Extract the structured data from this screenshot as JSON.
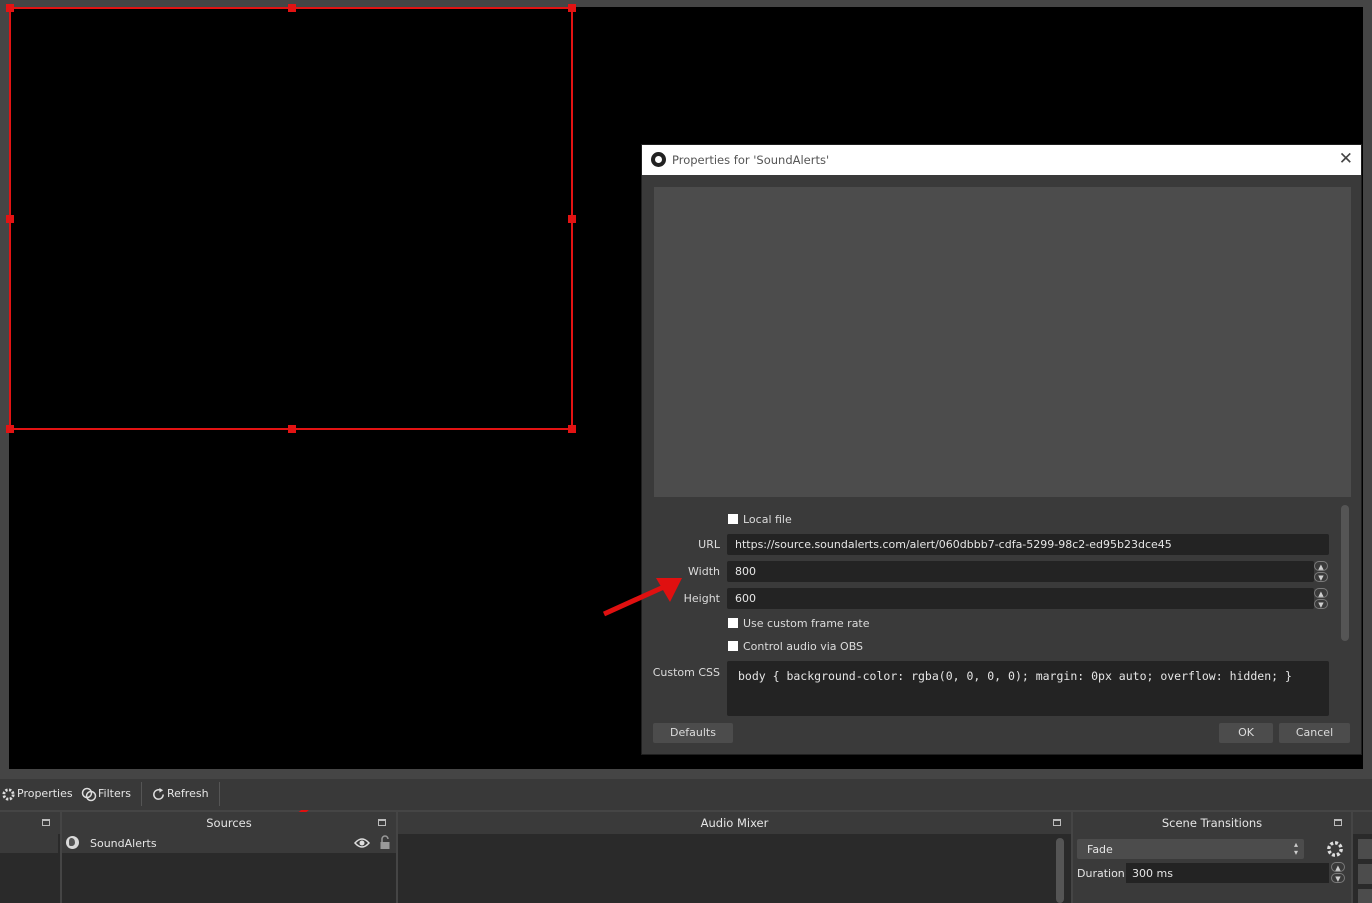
{
  "dialog": {
    "title": "Properties for 'SoundAlerts'",
    "local_file_label": "Local file",
    "url_label": "URL",
    "url_value": "https://source.soundalerts.com/alert/060dbbb7-cdfa-5299-98c2-ed95b23dce45",
    "width_label": "Width",
    "width_value": "800",
    "height_label": "Height",
    "height_value": "600",
    "custom_fps_label": "Use custom frame rate",
    "control_audio_label": "Control audio via OBS",
    "custom_css_label": "Custom CSS",
    "custom_css_value": "body { background-color: rgba(0, 0, 0, 0); margin: 0px auto; overflow: hidden; }",
    "defaults_label": "Defaults",
    "ok_label": "OK",
    "cancel_label": "Cancel",
    "close_glyph": "✕"
  },
  "toolbar": {
    "properties_label": "Properties",
    "filters_label": "Filters",
    "refresh_label": "Refresh"
  },
  "docks": {
    "sources_title": "Sources",
    "source_item": "SoundAlerts",
    "audio_mixer_title": "Audio Mixer",
    "scene_transitions_title": "Scene Transitions",
    "transition_value": "Fade",
    "duration_label": "Duration",
    "duration_value": "300 ms"
  },
  "colors": {
    "selection": "#e31313",
    "annotation_arrow": "#e01010",
    "panel_bg": "#2a2a2a",
    "preview_bg": "#000000"
  },
  "icons": [
    "obs-logo-icon",
    "close-icon",
    "gear-icon",
    "filters-icon",
    "refresh-icon",
    "globe-icon",
    "eye-icon",
    "lock-icon",
    "undock-icon",
    "chevron-up-icon",
    "chevron-down-icon",
    "arrow-annotation-icon"
  ]
}
